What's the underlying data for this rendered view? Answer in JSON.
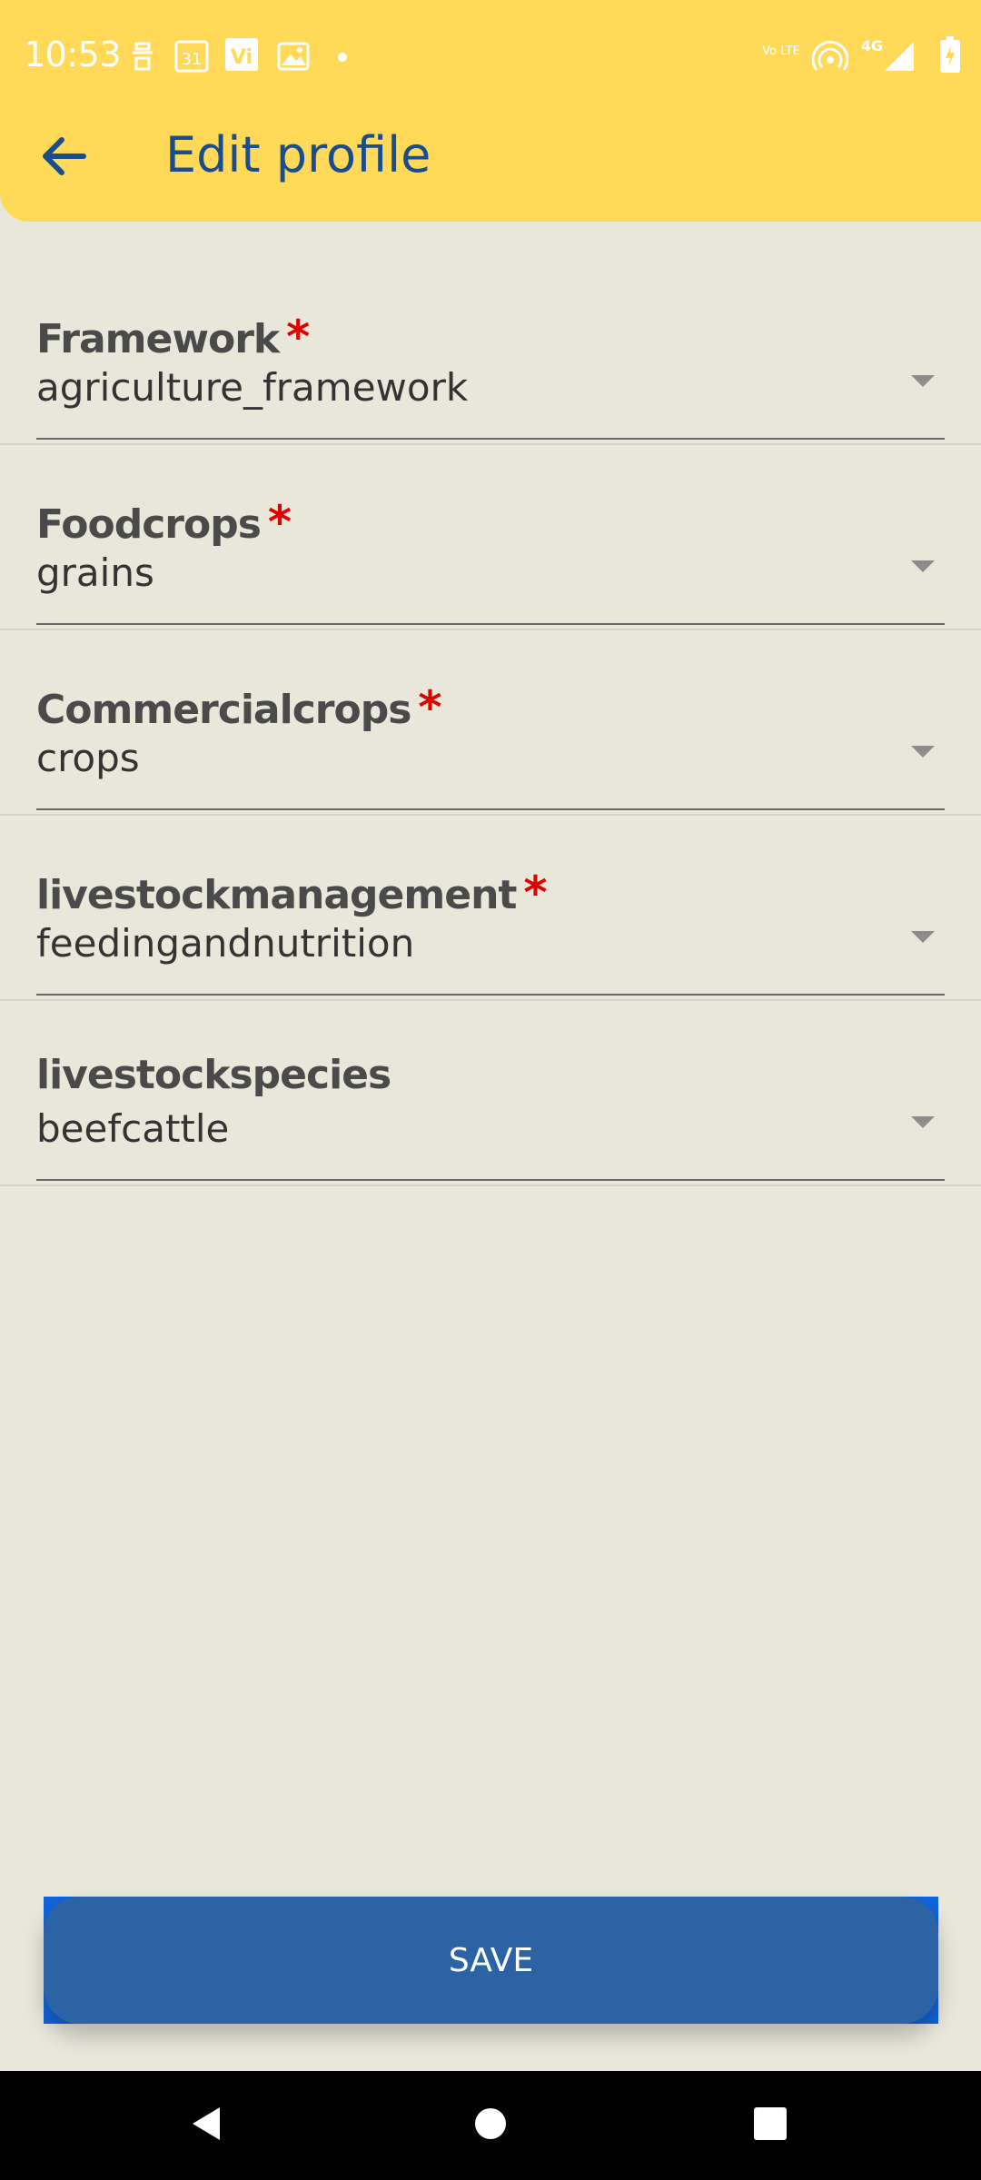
{
  "status_bar": {
    "time": "10:53",
    "icons": [
      "sim-icon",
      "calendar-icon",
      "vi-icon",
      "gallery-icon",
      "volte-icon",
      "hotspot-icon",
      "signal-4g-icon",
      "battery-icon"
    ],
    "calendar_day": "31",
    "vi_text": "Vi",
    "volte_text": "Vo LTE",
    "network_text": "4G"
  },
  "header": {
    "title": "Edit profile",
    "back_icon": "arrow-back-icon",
    "background": "#ffd957",
    "title_color": "#1a4d8c"
  },
  "form": {
    "fields": [
      {
        "label": "Framework",
        "required": true,
        "value": "agriculture_framework"
      },
      {
        "label": "Foodcrops",
        "required": true,
        "value": "grains"
      },
      {
        "label": "Commercialcrops",
        "required": true,
        "value": "crops"
      },
      {
        "label": "livestockmanagement",
        "required": true,
        "value": "feedingandnutrition"
      },
      {
        "label": "livestockspecies",
        "required": false,
        "value": "beefcattle"
      }
    ],
    "required_marker": "*"
  },
  "actions": {
    "save_label": "SAVE",
    "save_color": "#2b63a4"
  },
  "nav_bar": {
    "icons": [
      "nav-back-icon",
      "nav-home-icon",
      "nav-recents-icon"
    ]
  }
}
